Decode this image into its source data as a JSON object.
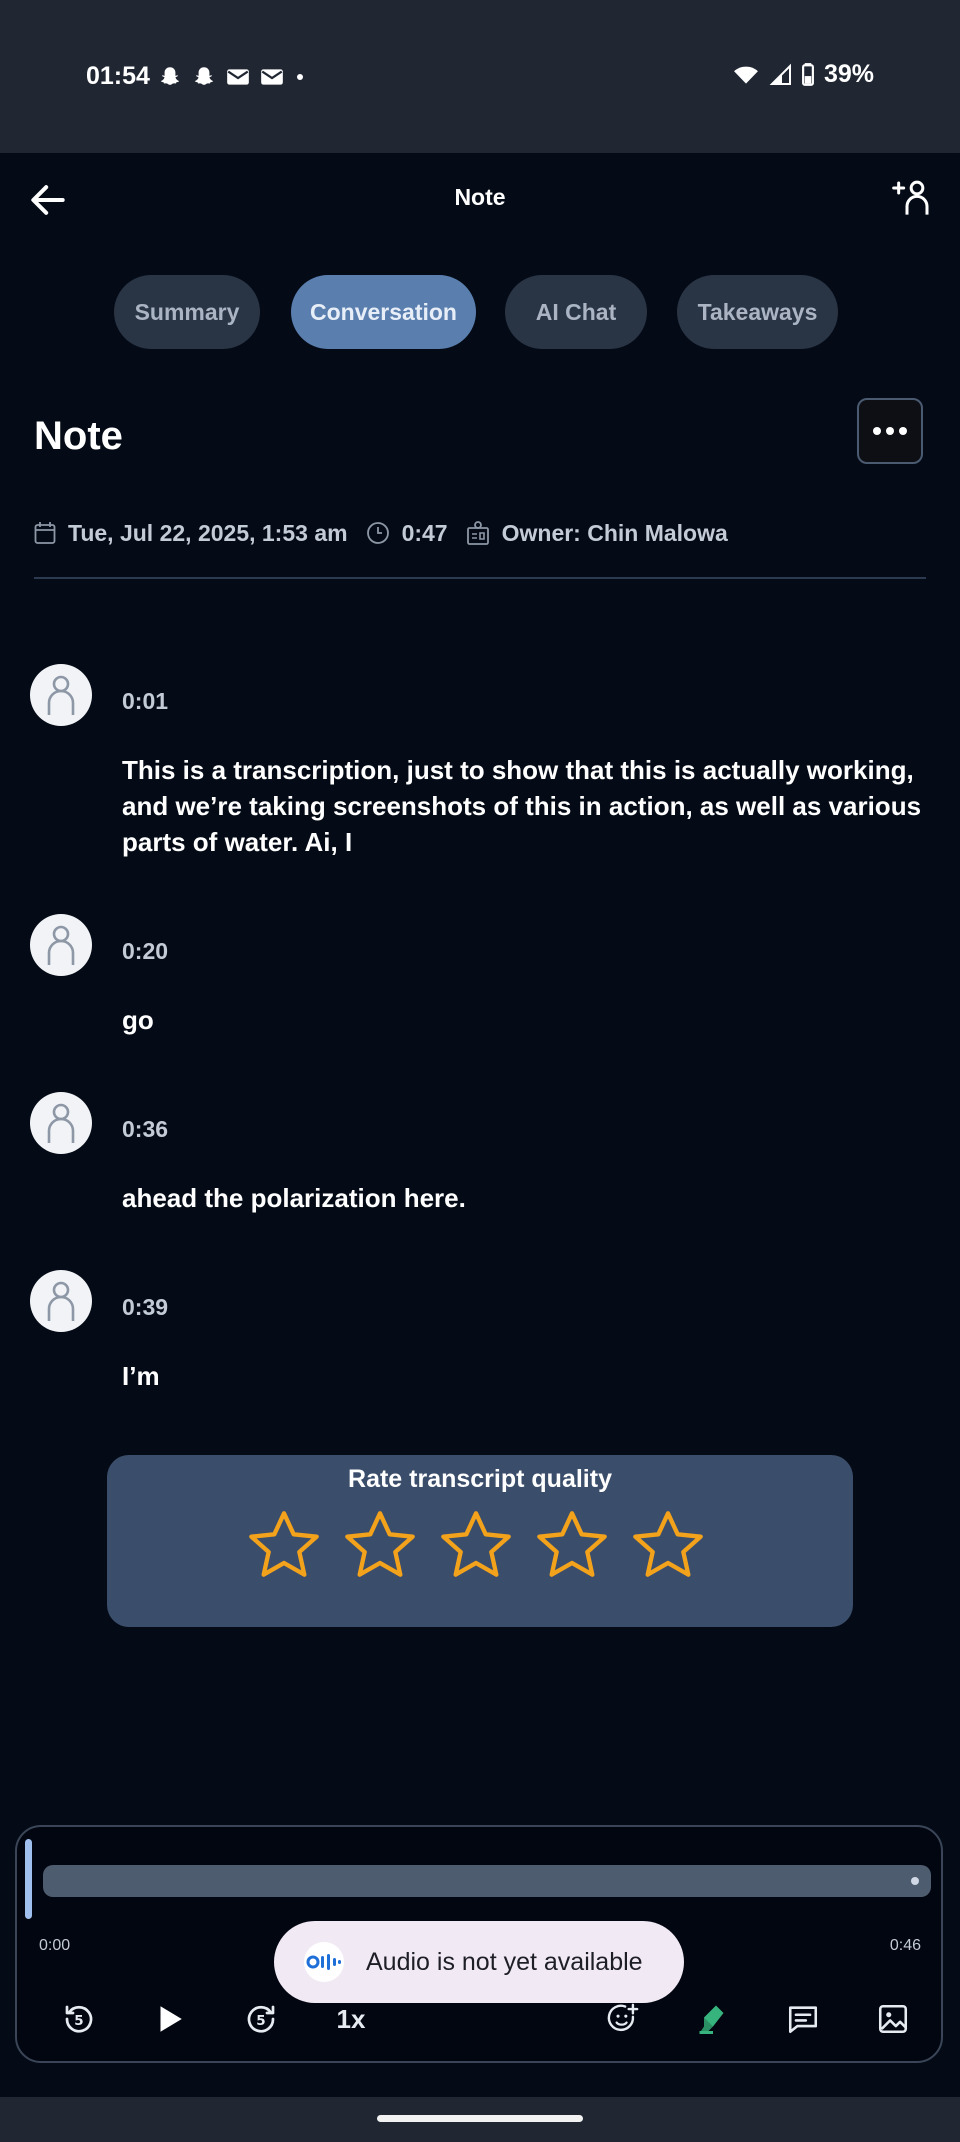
{
  "status_bar": {
    "time": "01:54",
    "notification_icons": [
      "snapchat-icon",
      "snapchat-icon",
      "mail-icon",
      "mail-icon",
      "dot-icon"
    ],
    "battery": "39%"
  },
  "app_bar": {
    "title": "Note"
  },
  "tabs": [
    {
      "label": "Summary",
      "active": false
    },
    {
      "label": "Conversation",
      "active": true
    },
    {
      "label": "AI Chat",
      "active": false
    },
    {
      "label": "Takeaways",
      "active": false
    }
  ],
  "note": {
    "title": "Note",
    "date": "Tue, Jul 22, 2025, 1:53 am",
    "duration": "0:47",
    "owner": "Owner: Chin Malowa"
  },
  "transcript": [
    {
      "time": "0:01",
      "text": "This is a transcription, just to show that this is actually working, and we’re taking screenshots of this in action, as well as various parts of water. Ai, I"
    },
    {
      "time": "0:20",
      "text": "go"
    },
    {
      "time": "0:36",
      "text": "ahead the polarization here."
    },
    {
      "time": "0:39",
      "text": "I’m"
    }
  ],
  "rating": {
    "title": "Rate transcript quality",
    "max_stars": 5,
    "selected": 0,
    "star_color": "#f3a21b"
  },
  "player": {
    "time_start": "0:00",
    "time_end": "0:46",
    "speed": "1x",
    "progress_fraction": 0
  },
  "toast": {
    "text": "Audio is not yet available"
  },
  "colors": {
    "background": "#040b16",
    "active_tab": "#5a7faf",
    "rating_card": "#3a4d6a",
    "accent_green": "#37b37e"
  }
}
